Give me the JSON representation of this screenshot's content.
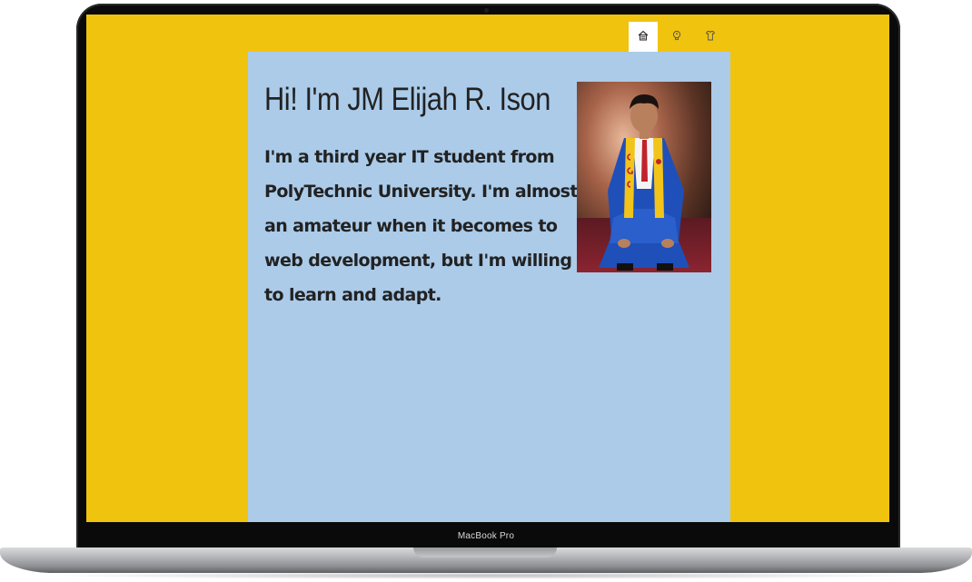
{
  "device": {
    "label": "MacBook Pro"
  },
  "colors": {
    "page_background": "#f0c30e",
    "card_background": "#abcbe9",
    "text": "#222222",
    "gown": "#1f4fb8",
    "stole": "#f2c41a"
  },
  "nav": {
    "items": [
      {
        "name": "home",
        "icon": "home-icon",
        "active": true
      },
      {
        "name": "about",
        "icon": "lightbulb-icon",
        "active": false
      },
      {
        "name": "projects",
        "icon": "shirt-icon",
        "active": false
      }
    ]
  },
  "hero": {
    "heading": "Hi! I'm JM Elijah R. Ison",
    "intro": "I'm a third year IT student from PolyTechnic University. I'm almost an amateur when it becomes to web development, but I'm willing to learn and adapt.",
    "photo": {
      "subject": "graduation-portrait",
      "stole_lettering": "CGC"
    }
  }
}
